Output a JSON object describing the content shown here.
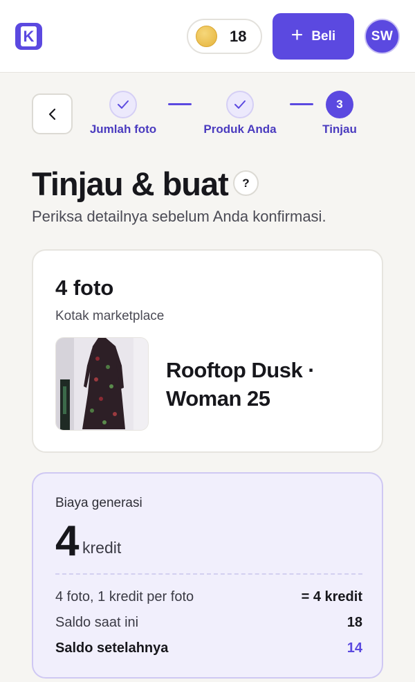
{
  "header": {
    "logo_letter": "K",
    "coin_count": "18",
    "buy_label": "Beli",
    "avatar_initials": "SW"
  },
  "stepper": {
    "steps": [
      {
        "label": "Jumlah foto",
        "state": "done"
      },
      {
        "label": "Produk Anda",
        "state": "done"
      },
      {
        "label": "Tinjau",
        "state": "active",
        "number": "3"
      }
    ]
  },
  "page": {
    "title": "Tinjau & buat",
    "help": "?",
    "subtitle": "Periksa detailnya sebelum Anda konfirmasi."
  },
  "summary": {
    "photo_count": "4 foto",
    "box_name": "Kotak marketplace",
    "product_name": "Rooftop Dusk · Woman 25"
  },
  "cost": {
    "label": "Biaya generasi",
    "amount": "4",
    "unit": "kredit",
    "rows": [
      {
        "label": "4 foto, 1 kredit per foto",
        "value": "= 4 kredit"
      },
      {
        "label": "Saldo saat ini",
        "value": "18"
      },
      {
        "label": "Saldo setelahnya",
        "value": "14"
      }
    ]
  },
  "colors": {
    "accent": "#5b49e0",
    "background": "#f6f5f2",
    "cost_panel": "#f1effc"
  }
}
